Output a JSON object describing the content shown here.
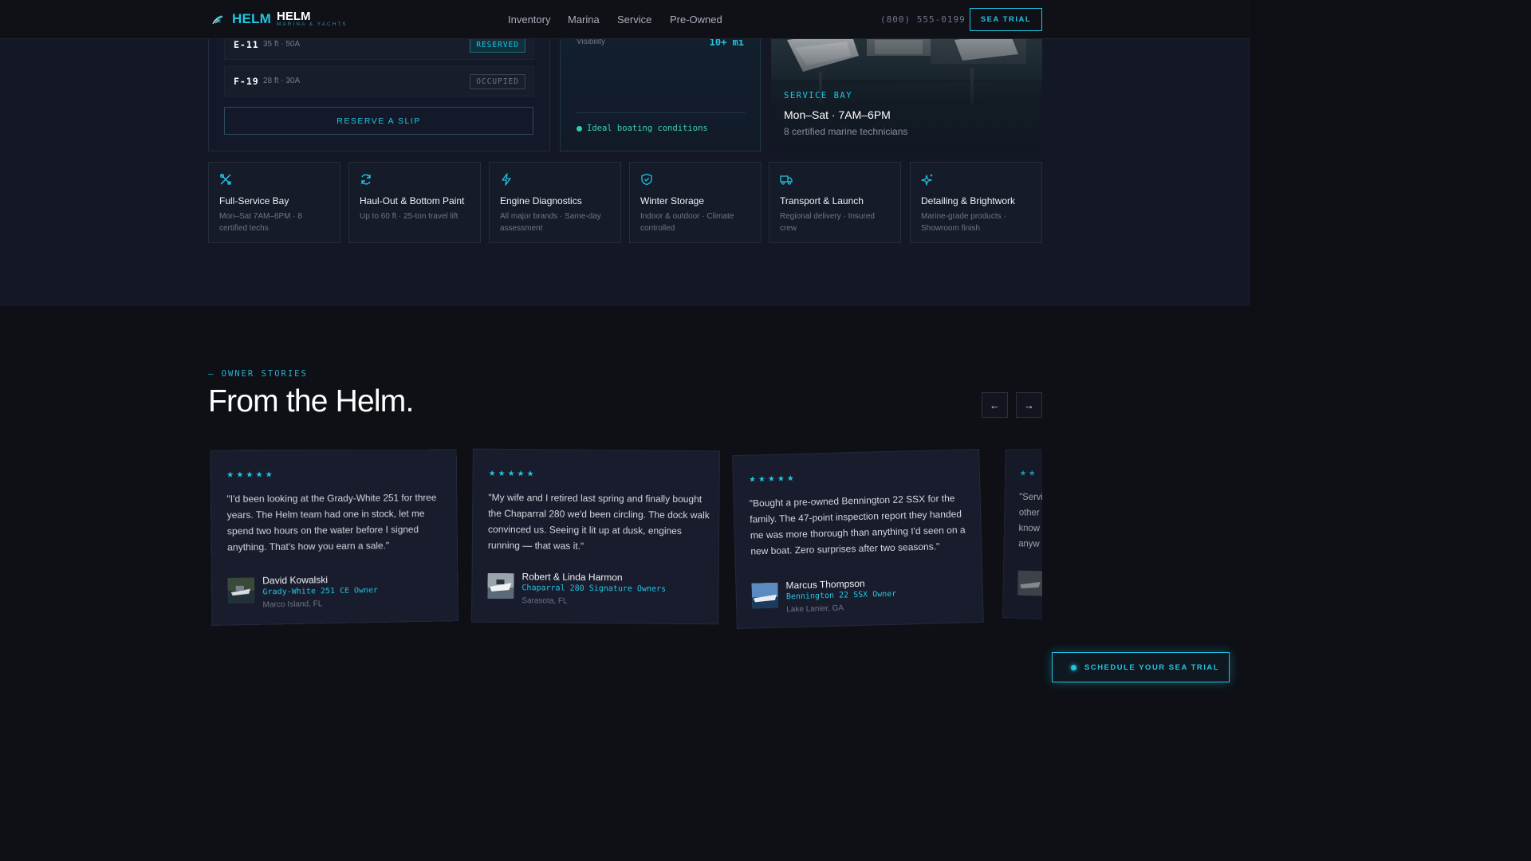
{
  "nav": {
    "brand": "HELM",
    "brand_title": "HELM",
    "brand_subtitle": "MARINA & YACHTS",
    "links": [
      "Inventory",
      "Marina",
      "Service",
      "Pre-Owned"
    ],
    "phone": "(800) 555-0199",
    "cta_label": "SEA TRIAL"
  },
  "slips": {
    "rows": [
      {
        "id": "E-11",
        "spec": "35 ft · 50A",
        "status": "RESERVED"
      },
      {
        "id": "F-19",
        "spec": "28 ft · 30A",
        "status": "OCCUPIED"
      }
    ],
    "reserve_label": "RESERVE A SLIP"
  },
  "conditions": {
    "label": "Visibility",
    "value": "10+ mi",
    "status": "Ideal boating conditions"
  },
  "service_bay": {
    "kicker": "SERVICE BAY",
    "hours": "Mon–Sat · 7AM–6PM",
    "note": "8 certified marine technicians"
  },
  "services": [
    {
      "icon": "wrench-icon",
      "title": "Full-Service Bay",
      "desc": "Mon–Sat 7AM–6PM · 8 certified techs"
    },
    {
      "icon": "refresh-icon",
      "title": "Haul-Out & Bottom Paint",
      "desc": "Up to 60 ft · 25-ton travel lift"
    },
    {
      "icon": "bolt-icon",
      "title": "Engine Diagnostics",
      "desc": "All major brands · Same-day assessment"
    },
    {
      "icon": "shield-icon",
      "title": "Winter Storage",
      "desc": "Indoor & outdoor · Climate controlled"
    },
    {
      "icon": "truck-icon",
      "title": "Transport & Launch",
      "desc": "Regional delivery · Insured crew"
    },
    {
      "icon": "sparkles-icon",
      "title": "Detailing & Brightwork",
      "desc": "Marine-grade products · Showroom finish"
    }
  ],
  "stories": {
    "kicker": "— OWNER STORIES",
    "heading": "From the Helm.",
    "prev": "←",
    "next": "→",
    "testimonials": [
      {
        "stars": "★★★★★",
        "quote": "\"I'd been looking at the Grady-White 251 for three years. The Helm team had one in stock, let me spend two hours on the water before I signed anything. That's how you earn a sale.\"",
        "name": "David Kowalski",
        "boat": "Grady-White 251 CE Owner",
        "location": "Marco Island, FL"
      },
      {
        "stars": "★★★★★",
        "quote": "\"My wife and I retired last spring and finally bought the Chaparral 280 we'd been circling. The dock walk convinced us. Seeing it lit up at dusk, engines running — that was it.\"",
        "name": "Robert & Linda Harmon",
        "boat": "Chaparral 280 Signature Owners",
        "location": "Sarasota, FL"
      },
      {
        "stars": "★★★★★",
        "quote": "\"Bought a pre-owned Bennington 22 SSX for the family. The 47-point inspection report they handed me was more thorough than anything I'd seen on a new boat. Zero surprises after two seasons.\"",
        "name": "Marcus Thompson",
        "boat": "Bennington 22 SSX Owner",
        "location": "Lake Lanier, GA"
      },
      {
        "stars": "★★",
        "quote": "\"Servi other know anyw",
        "name": "",
        "boat": "",
        "location": ""
      }
    ]
  },
  "floating_cta": "SCHEDULE YOUR SEA TRIAL",
  "colors": {
    "accent": "#22c4e0",
    "success": "#2ecfa8",
    "background": "#0e1016",
    "panel": "#161b2a"
  }
}
